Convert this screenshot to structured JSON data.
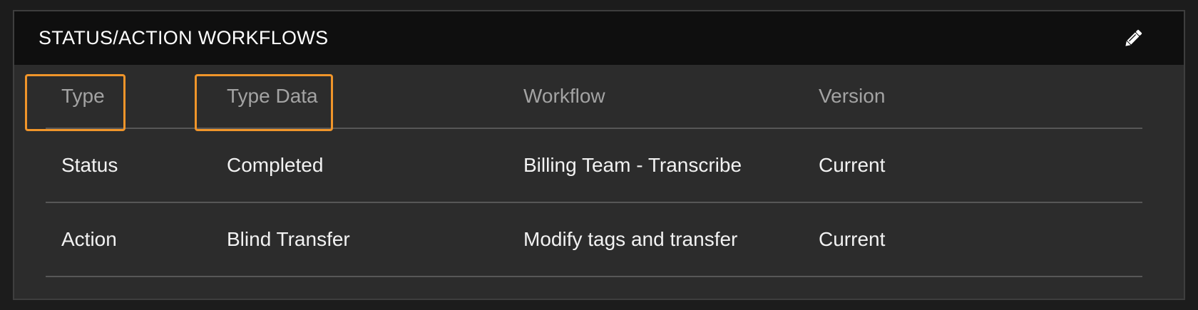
{
  "panel": {
    "title": "STATUS/ACTION WORKFLOWS",
    "edit_icon": "pencil-icon"
  },
  "table": {
    "columns": [
      "Type",
      "Type Data",
      "Workflow",
      "Version"
    ],
    "rows": [
      [
        "Status",
        "Completed",
        "Billing Team - Transcribe",
        "Current"
      ],
      [
        "Action",
        "Blind Transfer",
        "Modify tags and transfer",
        "Current"
      ]
    ]
  },
  "colors": {
    "header_bar": "#0f0f0f",
    "panel_bg": "#2c2c2c",
    "highlight": "#f0952a"
  }
}
